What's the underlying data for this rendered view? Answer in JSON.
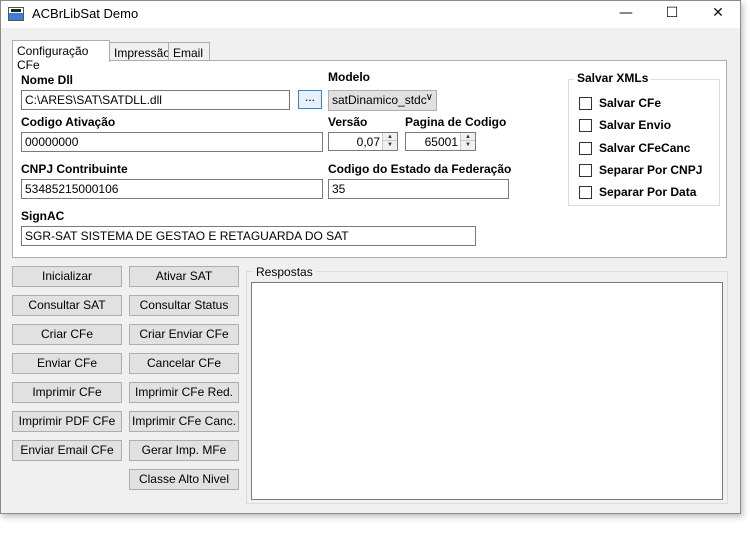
{
  "window": {
    "title": "ACBrLibSat Demo"
  },
  "titlebar": {
    "minimize": "—",
    "maximize": "☐",
    "close": "✕"
  },
  "tabs": [
    {
      "label": "Configuração CFe",
      "active": true
    },
    {
      "label": "Impressão",
      "active": false
    },
    {
      "label": "Email",
      "active": false
    }
  ],
  "config": {
    "nome_dll_label": "Nome Dll",
    "nome_dll_value": "C:\\ARES\\SAT\\SATDLL.dll",
    "browse_label": "...",
    "modelo_label": "Modelo",
    "modelo_value": "satDinamico_stdc",
    "codigo_ativacao_label": "Codigo Ativação",
    "codigo_ativacao_value": "00000000",
    "versao_label": "Versão",
    "versao_value": "0,07",
    "pagina_codigo_label": "Pagina de Codigo",
    "pagina_codigo_value": "65001",
    "cnpj_label": "CNPJ Contribuinte",
    "cnpj_value": "53485215000106",
    "codigo_estado_label": "Codigo do Estado da Federação",
    "codigo_estado_value": "35",
    "signac_label": "SignAC",
    "signac_value": "SGR-SAT SISTEMA DE GESTAO E RETAGUARDA DO SAT"
  },
  "salvar_xmls": {
    "title": "Salvar XMLs",
    "options": [
      {
        "label": "Salvar CFe",
        "checked": false
      },
      {
        "label": "Salvar Envio",
        "checked": false
      },
      {
        "label": "Salvar CFeCanc",
        "checked": false
      },
      {
        "label": "Separar Por CNPJ",
        "checked": false
      },
      {
        "label": "Separar Por Data",
        "checked": false
      }
    ]
  },
  "actions": {
    "inicializar": "Inicializar",
    "ativar_sat": "Ativar SAT",
    "consultar_sat": "Consultar SAT",
    "consultar_status": "Consultar Status",
    "criar_cfe": "Criar CFe",
    "criar_enviar_cfe": "Criar Enviar CFe",
    "enviar_cfe": "Enviar CFe",
    "cancelar_cfe": "Cancelar CFe",
    "imprimir_cfe": "Imprimir CFe",
    "imprimir_cfe_red": "Imprimir CFe Red.",
    "imprimir_pdf_cfe": "Imprimir PDF CFe",
    "imprimir_cfe_canc": "Imprimir CFe Canc.",
    "enviar_email_cfe": "Enviar Email CFe",
    "gerar_imp_mfe": "Gerar Imp. MFe",
    "classe_alto_nivel": "Classe Alto Nivel"
  },
  "respostas": {
    "title": "Respostas",
    "content": ""
  }
}
